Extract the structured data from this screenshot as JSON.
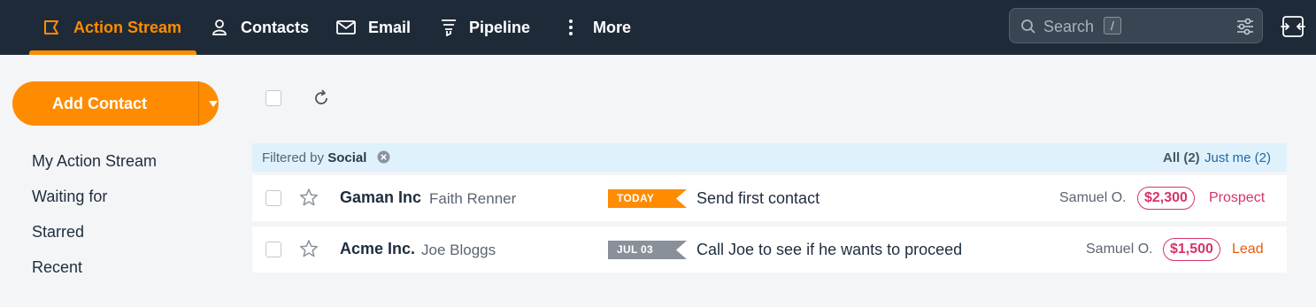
{
  "nav": {
    "items": [
      {
        "label": "Action Stream",
        "icon": "action-stream-icon",
        "active": true
      },
      {
        "label": "Contacts",
        "icon": "person-icon"
      },
      {
        "label": "Email",
        "icon": "envelope-icon"
      },
      {
        "label": "Pipeline",
        "icon": "funnel-icon"
      },
      {
        "label": "More",
        "icon": "kebab-icon"
      }
    ],
    "search_placeholder": "Search",
    "search_shortcut": "/"
  },
  "sidebar": {
    "add_contact_label": "Add Contact",
    "items": [
      {
        "label": "My Action Stream"
      },
      {
        "label": "Waiting for"
      },
      {
        "label": "Starred"
      },
      {
        "label": "Recent"
      }
    ]
  },
  "filter": {
    "prefix": "Filtered by",
    "value": "Social",
    "all_label": "All (2)",
    "me_label": "Just me (2)"
  },
  "rows": [
    {
      "company": "Gaman Inc",
      "person": "Faith Renner",
      "tag": "TODAY",
      "tag_color": "#ff8c00",
      "task": "Send first contact",
      "owner": "Samuel O.",
      "amount": "$2,300",
      "stage": "Prospect",
      "stage_color": "#d6336c"
    },
    {
      "company": "Acme Inc.",
      "person": "Joe Bloggs",
      "tag": "JUL 03",
      "tag_color": "#8a9099",
      "task": "Call Joe to see if he wants to proceed",
      "owner": "Samuel O.",
      "amount": "$1,500",
      "stage": "Lead",
      "stage_color": "#e8590c"
    }
  ],
  "colors": {
    "accent": "#ff8c00",
    "nav_bg": "#1e2a38",
    "amount": "#d6336c"
  }
}
